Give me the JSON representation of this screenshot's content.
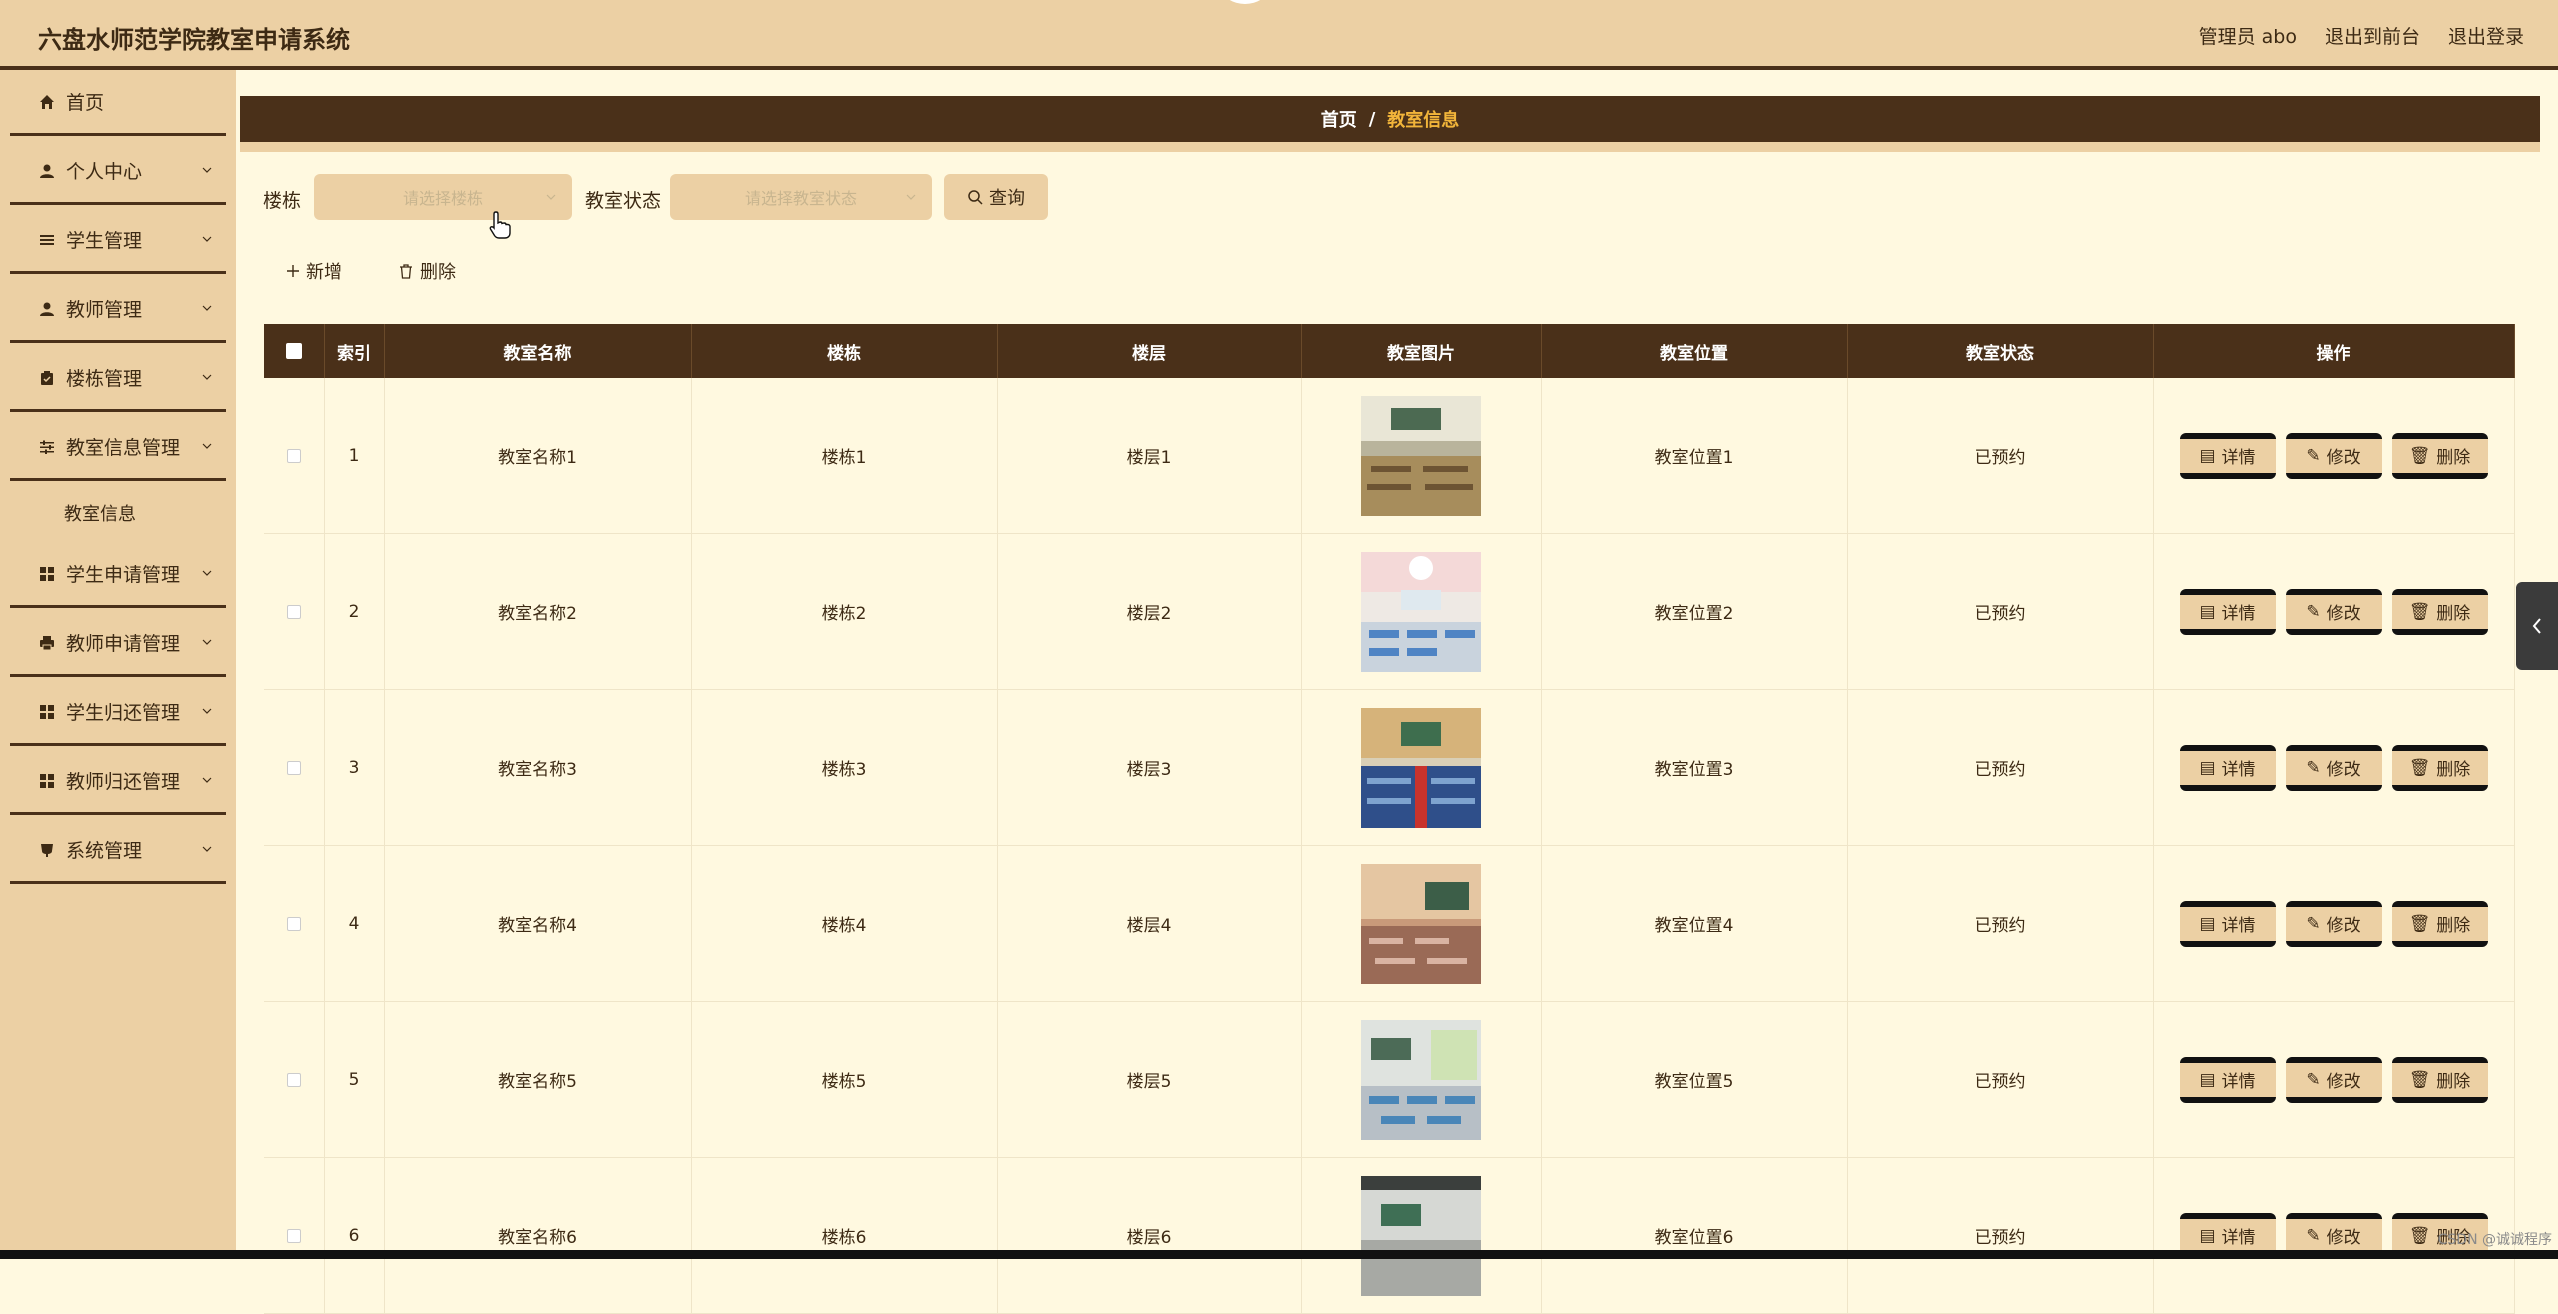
{
  "header": {
    "title": "六盘水师范学院教室申请系统",
    "admin": "管理员 abo",
    "front": "退出到前台",
    "logout": "退出登录"
  },
  "sidebar": {
    "items": [
      {
        "label": "首页",
        "icon": "home-icon"
      },
      {
        "label": "个人中心",
        "icon": "user-icon"
      },
      {
        "label": "学生管理",
        "icon": "list-icon"
      },
      {
        "label": "教师管理",
        "icon": "user-icon"
      },
      {
        "label": "楼栋管理",
        "icon": "clipboard-icon"
      },
      {
        "label": "教室信息管理",
        "icon": "sliders-icon"
      },
      {
        "label": "学生申请管理",
        "icon": "grid-icon"
      },
      {
        "label": "教师申请管理",
        "icon": "printer-icon"
      },
      {
        "label": "学生归还管理",
        "icon": "grid-icon"
      },
      {
        "label": "教师归还管理",
        "icon": "grid-icon"
      },
      {
        "label": "系统管理",
        "icon": "cup-icon"
      }
    ],
    "sub_item": "教室信息"
  },
  "breadcrumb": {
    "home": "首页",
    "sep": "/",
    "current": "教室信息"
  },
  "filters": {
    "building_label": "楼栋",
    "building_placeholder": "请选择楼栋",
    "status_label": "教室状态",
    "status_placeholder": "请选择教室状态",
    "query": "查询"
  },
  "actions": {
    "add": "新增",
    "delete": "删除"
  },
  "table": {
    "headers": [
      "索引",
      "教室名称",
      "楼栋",
      "楼层",
      "教室图片",
      "教室位置",
      "教室状态",
      "操作"
    ],
    "rows": [
      {
        "index": "1",
        "name": "教室名称1",
        "building": "楼栋1",
        "floor": "楼层1",
        "location": "教室位置1",
        "status": "已预约"
      },
      {
        "index": "2",
        "name": "教室名称2",
        "building": "楼栋2",
        "floor": "楼层2",
        "location": "教室位置2",
        "status": "已预约"
      },
      {
        "index": "3",
        "name": "教室名称3",
        "building": "楼栋3",
        "floor": "楼层3",
        "location": "教室位置3",
        "status": "已预约"
      },
      {
        "index": "4",
        "name": "教室名称4",
        "building": "楼栋4",
        "floor": "楼层4",
        "location": "教室位置4",
        "status": "已预约"
      },
      {
        "index": "5",
        "name": "教室名称5",
        "building": "楼栋5",
        "floor": "楼层5",
        "location": "教室位置5",
        "status": "已预约"
      },
      {
        "index": "6",
        "name": "教室名称6",
        "building": "楼栋6",
        "floor": "楼层6",
        "location": "教室位置6",
        "status": "已预约"
      }
    ],
    "ops": {
      "detail": "详情",
      "edit": "修改",
      "delete": "删除"
    }
  },
  "watermark": "CSDN @诚诚程序",
  "colors": {
    "accent": "#ecd0a4",
    "dark": "#4a3019",
    "background": "#fff9e0",
    "highlight": "#f2b53a"
  }
}
